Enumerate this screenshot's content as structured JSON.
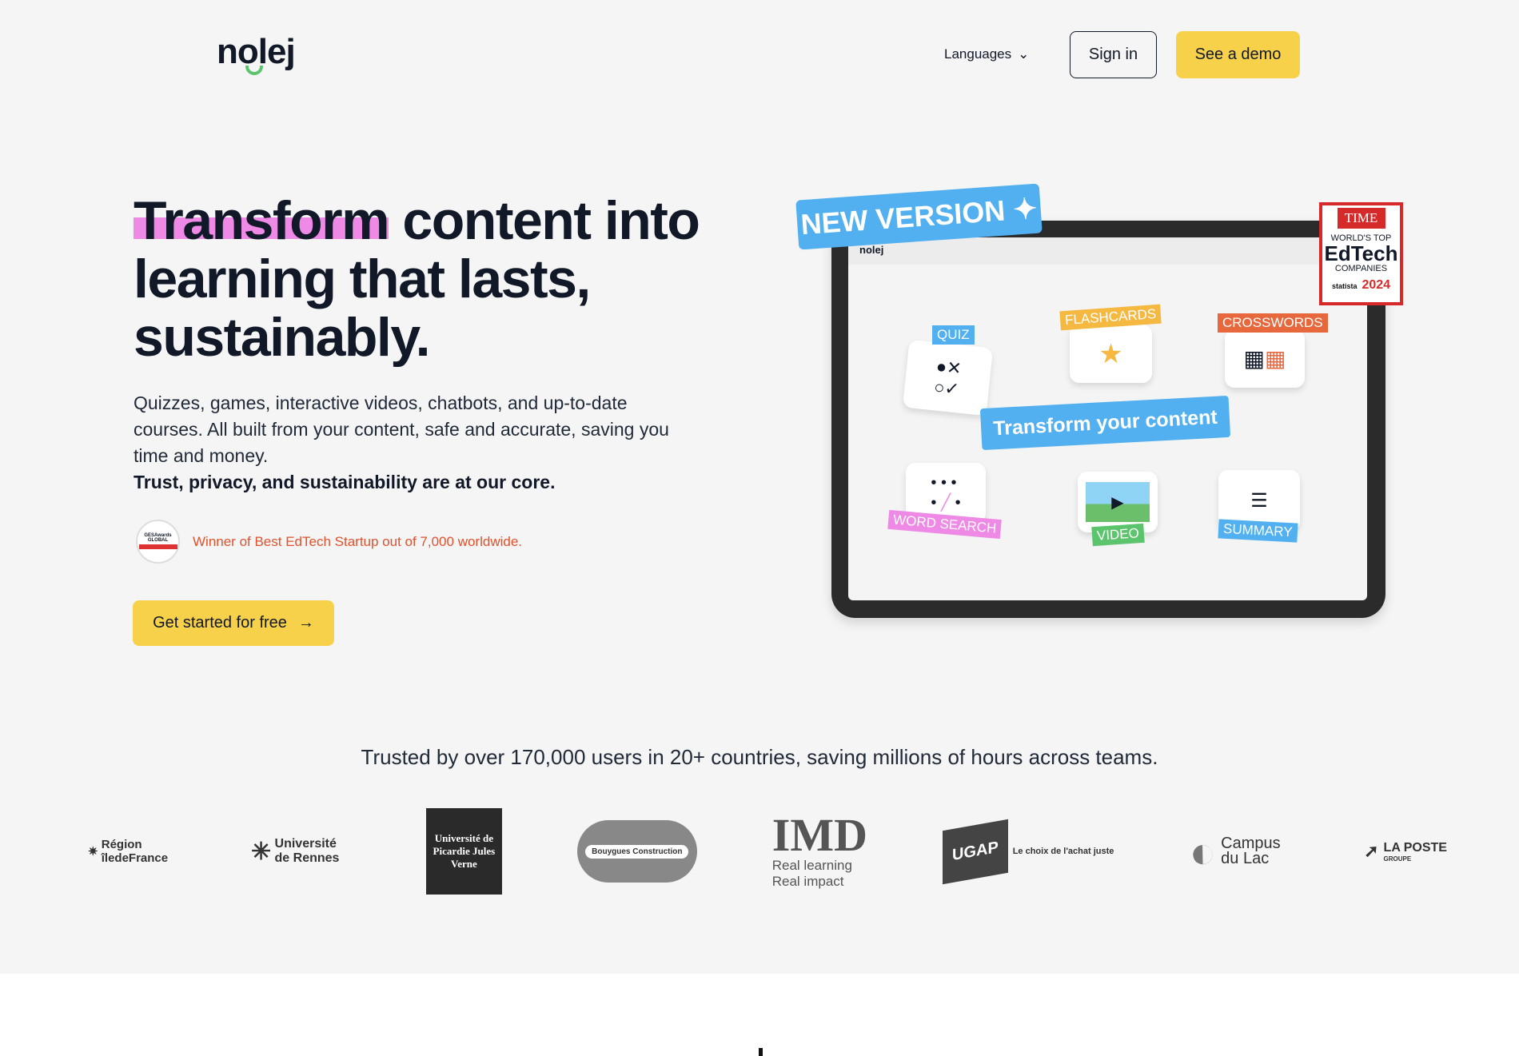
{
  "header": {
    "logo": "nolej",
    "languages": "Languages",
    "sign_in": "Sign in",
    "see_demo": "See a demo"
  },
  "hero": {
    "headline_highlight": "Transform",
    "headline_rest": " content into learning that lasts, sustainably.",
    "description": "Quizzes, games, interactive videos, chatbots, and up-to-date courses. All built from your content, safe and accurate, saving you time and money.",
    "emphasis": "Trust, privacy, and sustainability are at our core.",
    "award_badge": "GESAwards GLOBAL",
    "award_text": "Winner of Best EdTech Startup out of 7,000 worldwide.",
    "cta": "Get started for free"
  },
  "illustration": {
    "new_version": "NEW VERSION",
    "app_logo": "nolej",
    "center_pill": "Transform your content",
    "cards": [
      {
        "label": "QUIZ",
        "color": "#52b0f0"
      },
      {
        "label": "FLASHCARDS",
        "color": "#f5b942"
      },
      {
        "label": "CROSSWORDS",
        "color": "#e8683d"
      },
      {
        "label": "WORD SEARCH",
        "color": "#ee8ae6"
      },
      {
        "label": "VIDEO",
        "color": "#5cc46d"
      },
      {
        "label": "SUMMARY",
        "color": "#52b0f0"
      }
    ],
    "time_badge": {
      "brand": "TIME",
      "line1": "WORLD'S TOP",
      "line2": "EdTech",
      "line3": "COMPANIES",
      "partner": "statista",
      "year": "2024"
    }
  },
  "trusted": {
    "text": "Trusted by over 170,000 users in 20+ countries, saving millions of hours across teams.",
    "logos": [
      "Région îledeFrance",
      "Université de Rennes",
      "Université de Picardie Jules Verne",
      "Bouygues Construction",
      "IMD",
      "Real learning",
      "Real impact",
      "UGAP",
      "Le choix de l'achat juste",
      "Campus du Lac",
      "LA POSTE",
      "GROUPE"
    ]
  },
  "colors": {
    "accent_yellow": "#f7d14a",
    "highlight_pink": "#ee8ae6",
    "award_red": "#e2512c",
    "blue": "#52b0f0"
  }
}
